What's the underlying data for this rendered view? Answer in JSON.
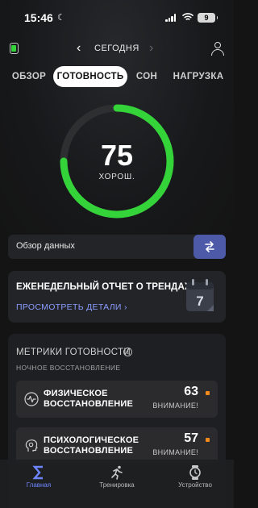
{
  "status_bar": {
    "time": "15:46",
    "battery": "9"
  },
  "header": {
    "date_label": "СЕГОДНЯ",
    "prev_glyph": "‹",
    "next_glyph": "›"
  },
  "tabs": [
    {
      "label": "ОБЗОР",
      "active": false
    },
    {
      "label": "ГОТОВНОСТЬ",
      "active": true
    },
    {
      "label": "СОН",
      "active": false
    },
    {
      "label": "НАГРУЗКА",
      "active": false
    }
  ],
  "readiness": {
    "score": "75",
    "label": "ХОРОШ.",
    "progress_fraction": 0.75
  },
  "overview": {
    "label": "Обзор данных"
  },
  "weekly_report": {
    "title": "ЕЖЕНЕДЕЛЬНЫЙ ОТЧЕТ О ТРЕНДАХ",
    "link": "ПРОСМОТРЕТЬ ДЕТАЛИ ›",
    "calendar_day": "7"
  },
  "metrics": {
    "title": "МЕТРИКИ ГОТОВНОСТИ",
    "subtitle": "НОЧНОЕ ВОССТАНОВЛЕНИЕ",
    "items": [
      {
        "line1": "ФИЗИЧЕСКОЕ",
        "line2": "ВОССТАНОВЛЕНИЕ",
        "value": "63",
        "status": "ВНИМАНИЕ!",
        "icon": "pulse-icon"
      },
      {
        "line1": "ПСИХОЛОГИЧЕСКОЕ",
        "line2": "ВОССТАНОВЛЕНИЕ",
        "value": "57",
        "status": "ВНИМАНИЕ!",
        "icon": "brain-icon"
      }
    ]
  },
  "bottom_nav": [
    {
      "label": "Главная",
      "icon": "sigma-icon",
      "active": true
    },
    {
      "label": "Тренировка",
      "icon": "runner-icon",
      "active": false
    },
    {
      "label": "Устройство",
      "icon": "watch-icon",
      "active": false
    }
  ],
  "colors": {
    "accent_green": "#34d33a",
    "accent_blue": "#4d5aa8",
    "link": "#8b9cff",
    "warning": "#f08a1c",
    "nav_active": "#6d86ff"
  }
}
